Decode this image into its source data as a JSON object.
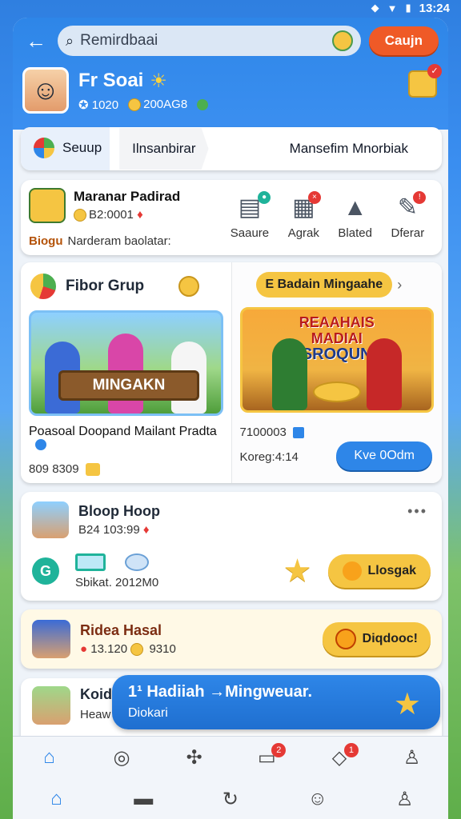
{
  "status": {
    "time": "13:24"
  },
  "header": {
    "search_value": "Remirdbaai",
    "cta_label": "Caujn",
    "profile_name": "Fr Soai",
    "stat1": "1020",
    "stat2": "200AG8"
  },
  "tabs": [
    {
      "label": "Seuup"
    },
    {
      "label": "Ilnsanbirar"
    },
    {
      "label": "Mansefim Mnorbiak"
    }
  ],
  "quick": {
    "title": "Maranar Padirad",
    "sub": "B2:0001",
    "tag": "Biogu",
    "desc": "Narderam baolatar:",
    "actions": [
      {
        "label": "Saaure",
        "icon": "document-icon"
      },
      {
        "label": "Agrak",
        "icon": "calendar-icon"
      },
      {
        "label": "Blated",
        "icon": "arrow-up-icon"
      },
      {
        "label": "Dferar",
        "icon": "wrench-icon"
      }
    ]
  },
  "featured": {
    "left": {
      "heading": "Fibor Grup",
      "image_sign": "MINGAKN",
      "title": "Poasoal Doopand Mailant Pradta",
      "meta": "809 8309"
    },
    "right": {
      "pill": "E Badain Mingaahe",
      "banner_line1": "REAAHAIS",
      "banner_line2": "MADIAI",
      "banner_line3": "SROQUN",
      "meta1": "7100003",
      "meta2": "Koreg:4:14",
      "button": "Kve 0Odm"
    }
  },
  "player": {
    "title": "Bloop Hoop",
    "sub": "B24 103:99",
    "stat": "Sbikat. 2012M0",
    "button": "Llosgak"
  },
  "reward": {
    "title": "Ridea Hasal",
    "sub1": "13.120",
    "sub2": "9310",
    "button": "Diqdooc!"
  },
  "lastcard": {
    "title": "Koid",
    "sub": "Heaw"
  },
  "toast": {
    "title": "1¹ Hadiiah →Mingweuar.",
    "sub": "Diokari"
  },
  "nav": {
    "row1_badges": [
      "2",
      "1"
    ]
  },
  "colors": {
    "primary": "#2e86e8",
    "accent": "#f5c542",
    "cta": "#ef5a27",
    "badge": "#e53935"
  }
}
